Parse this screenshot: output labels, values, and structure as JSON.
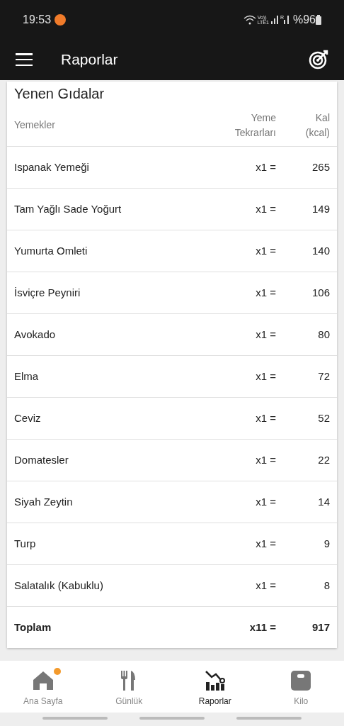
{
  "status_bar": {
    "time": "19:53",
    "volte": "Vo))",
    "lte": "LTE1",
    "roaming": "R",
    "battery": "%96"
  },
  "app_bar": {
    "title": "Raporlar"
  },
  "card": {
    "title": "Yenen Gıdalar",
    "columns": [
      "Yemekler",
      "Yeme Tekrarları",
      "Kal (kcal)"
    ],
    "rows": [
      {
        "name": "Ispanak Yemeği",
        "count": "x1 =",
        "kcal": "265"
      },
      {
        "name": "Tam Yağlı Sade Yoğurt",
        "count": "x1 =",
        "kcal": "149"
      },
      {
        "name": "Yumurta Omleti",
        "count": "x1 =",
        "kcal": "140"
      },
      {
        "name": "İsviçre Peyniri",
        "count": "x1 =",
        "kcal": "106"
      },
      {
        "name": "Avokado",
        "count": "x1 =",
        "kcal": "80"
      },
      {
        "name": "Elma",
        "count": "x1 =",
        "kcal": "72"
      },
      {
        "name": "Ceviz",
        "count": "x1 =",
        "kcal": "52"
      },
      {
        "name": "Domatesler",
        "count": "x1 =",
        "kcal": "22"
      },
      {
        "name": "Siyah Zeytin",
        "count": "x1 =",
        "kcal": "14"
      },
      {
        "name": "Turp",
        "count": "x1 =",
        "kcal": "9"
      },
      {
        "name": "Salatalık (Kabuklu)",
        "count": "x1 =",
        "kcal": "8"
      }
    ],
    "total": {
      "name": "Toplam",
      "count": "x11 =",
      "kcal": "917"
    }
  },
  "bottom_nav": [
    {
      "kind": "home",
      "label": "Ana Sayfa",
      "selected": false,
      "badge": true
    },
    {
      "kind": "diary",
      "label": "Günlük",
      "selected": false,
      "badge": false
    },
    {
      "kind": "reports",
      "label": "Raporlar",
      "selected": true,
      "badge": false
    },
    {
      "kind": "weight",
      "label": "Kilo",
      "selected": false,
      "badge": false
    }
  ]
}
